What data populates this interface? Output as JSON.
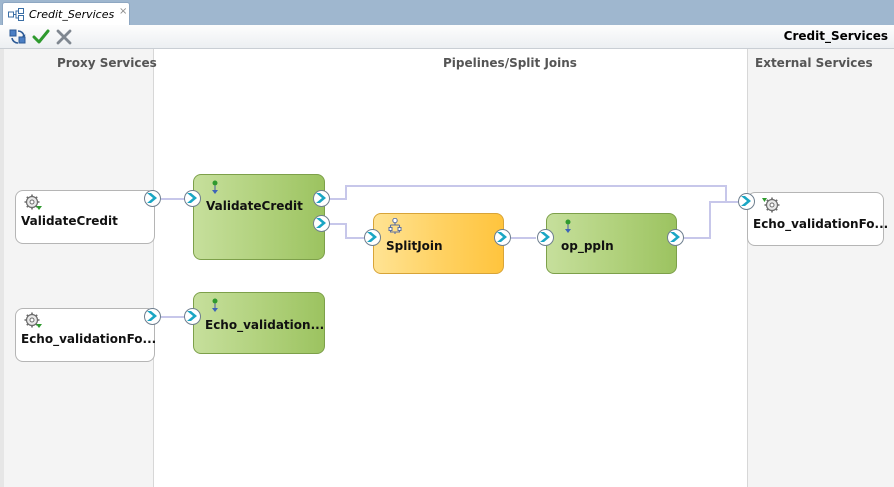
{
  "tab": {
    "title": "Credit_Services",
    "close": "×"
  },
  "toolbar": {
    "title": "Credit_Services"
  },
  "lanes": {
    "proxy": "Proxy Services",
    "pipelines": "Pipelines/Split Joins",
    "external": "External Services"
  },
  "proxy_services": [
    {
      "label": "ValidateCredit"
    },
    {
      "label": "Echo_validationFo..."
    }
  ],
  "pipelines": [
    {
      "label": "ValidateCredit"
    },
    {
      "label": "Echo_validation..."
    },
    {
      "label": "SplitJoin"
    },
    {
      "label": "op_ppln"
    }
  ],
  "external_services": [
    {
      "label": "Echo_validationFo..."
    }
  ],
  "colors": {
    "pipeline_green": "#b2d27e",
    "splitjoin_orange": "#ffd264",
    "wire": "#c7c7ea",
    "port_arrow": "#1aa6c4",
    "tabstrip": "#9fb7cf"
  }
}
